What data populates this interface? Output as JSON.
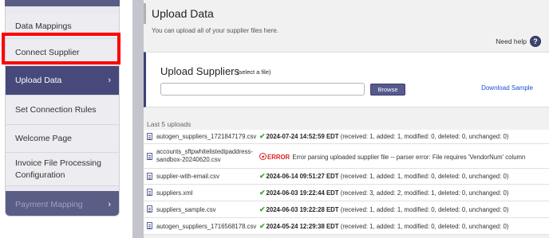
{
  "sidebar": {
    "items": [
      {
        "label": "Data Mappings",
        "state": "normal"
      },
      {
        "label": "Connect Supplier",
        "state": "normal"
      },
      {
        "label": "Upload Data",
        "state": "active",
        "chevron": "›"
      },
      {
        "label": "Set Connection Rules",
        "state": "normal"
      },
      {
        "label": "Welcome Page",
        "state": "normal"
      },
      {
        "label": "Invoice File Processing",
        "label2": "Configuration",
        "state": "normal"
      },
      {
        "label": "Payment Mapping",
        "state": "dim",
        "chevron": "›"
      }
    ]
  },
  "header": {
    "title": "Upload Data",
    "subtitle": "You can upload all of your supplier files here.",
    "need_help": "Need help",
    "help_icon": "?"
  },
  "upload": {
    "title": "Upload Suppliers",
    "hint": "(select a file)",
    "file_value": "",
    "browse_label": "Browse",
    "download_label": "Download Sample"
  },
  "last_uploads": {
    "label": "Last 5 uploads",
    "rows": [
      {
        "file": "autogen_suppliers_1721847179.csv",
        "file2": "",
        "type": "ok",
        "date": "2024-07-24 14:52:59 EDT",
        "detail": " (received: 1, added: 1, modified: 0, deleted: 0, unchanged: 0)"
      },
      {
        "file": "accounts_sftpwhitelistedipaddress-",
        "file2": "sandbox-20240620.csv",
        "type": "error",
        "date": "ERROR",
        "detail": " Error parsing uploaded supplier file -- parser error: File requires 'VendorNum' column"
      },
      {
        "file": "supplier-with-email.csv",
        "file2": "",
        "type": "ok",
        "date": "2024-06-14 09:51:27 EDT",
        "detail": " (received: 1, added: 1, modified: 0, deleted: 0, unchanged: 0)"
      },
      {
        "file": "suppliers.xml",
        "file2": "",
        "type": "ok",
        "date": "2024-06-03 19:22:44 EDT",
        "detail": " (received: 3, added: 2, modified: 1, deleted: 0, unchanged: 0)"
      },
      {
        "file": "suppliers_sample.csv",
        "file2": "",
        "type": "ok",
        "date": "2024-06-03 19:22:28 EDT",
        "detail": " (received: 1, added: 1, modified: 0, deleted: 0, unchanged: 0)"
      },
      {
        "file": "autogen_suppliers_1716568178.csv",
        "file2": "",
        "type": "ok",
        "date": "2024-05-24 12:29:38 EDT",
        "detail": " (received: 1, added: 1, modified: 0, deleted: 0, unchanged: 0)"
      }
    ]
  },
  "icons": {
    "ok": "check-icon",
    "error": "error-icon",
    "file": "file-icon"
  },
  "colors": {
    "accent": "#46497a",
    "highlight": "#ff0000",
    "ok": "#3aa52d",
    "error": "#dd2222",
    "link": "#1f4fd6"
  }
}
